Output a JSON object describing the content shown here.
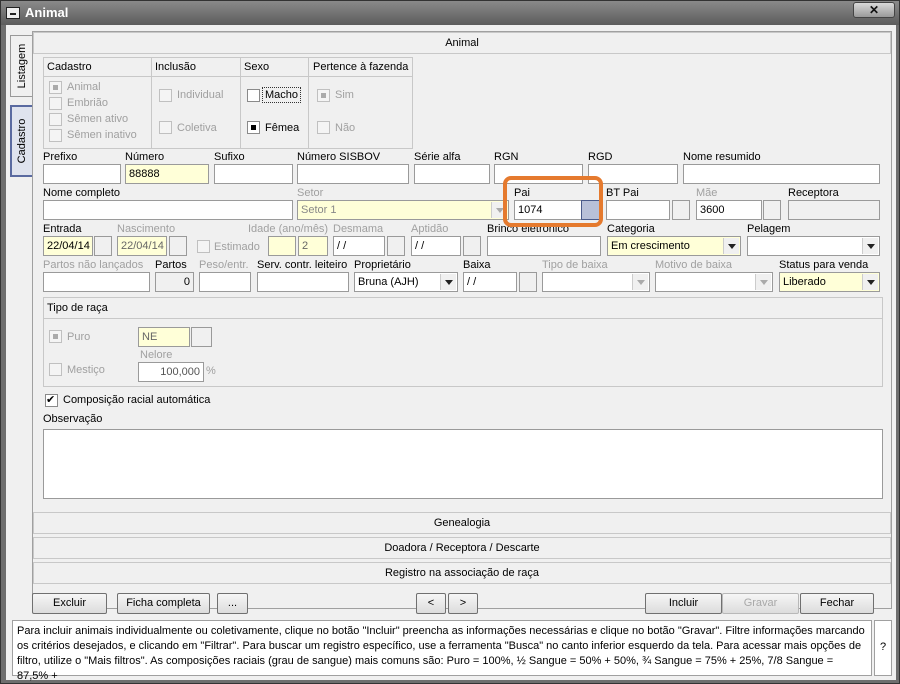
{
  "window": {
    "title": "Animal",
    "close": "✕"
  },
  "side_tabs": {
    "listagem": "Listagem",
    "cadastro": "Cadastro"
  },
  "sections": {
    "animal": "Animal",
    "genealogia": "Genealogia",
    "doadora": "Doadora / Receptora / Descarte",
    "registro": "Registro na associação de raça"
  },
  "cadastro_group": {
    "header": "Cadastro",
    "items": [
      "Animal",
      "Embrião",
      "Sêmen ativo",
      "Sêmen inativo"
    ]
  },
  "inclusao_group": {
    "header": "Inclusão",
    "items": [
      "Individual",
      "Coletiva"
    ]
  },
  "sexo_group": {
    "header": "Sexo",
    "items": [
      "Macho",
      "Fêmea"
    ]
  },
  "pertence_group": {
    "header": "Pertence à fazenda",
    "items": [
      "Sim",
      "Não"
    ]
  },
  "labels": {
    "prefixo": "Prefixo",
    "numero": "Número",
    "sufixo": "Sufixo",
    "sisbov": "Número SISBOV",
    "serie_alfa": "Série alfa",
    "rgn": "RGN",
    "rgd": "RGD",
    "nome_resumido": "Nome resumido",
    "nome_completo": "Nome completo",
    "setor": "Setor",
    "pai": "Pai",
    "bt_pai": "BT Pai",
    "mae": "Mãe",
    "receptora": "Receptora",
    "entrada": "Entrada",
    "nascimento": "Nascimento",
    "idade": "Idade (ano/mês)",
    "desmama": "Desmama",
    "aptidao": "Aptidão",
    "brinco": "Brinco eletrônico",
    "categoria": "Categoria",
    "pelagem": "Pelagem",
    "partos_nao_lancados": "Partos não lançados",
    "partos": "Partos",
    "peso_entr": "Peso/entr.",
    "serv_contr": "Serv. contr. leiteiro",
    "proprietario": "Proprietário",
    "baixa": "Baixa",
    "tipo_baixa": "Tipo de baixa",
    "motivo_baixa": "Motivo de baixa",
    "status_venda": "Status para venda",
    "tipo_raca": "Tipo de raça",
    "puro": "Puro",
    "mestico": "Mestiço",
    "nelore": "Nelore",
    "pct": "%",
    "composicao": "Composição racial automática",
    "observacao": "Observação",
    "estimado": "Estimado"
  },
  "values": {
    "numero": "88888",
    "setor": "Setor 1",
    "pai": "1074",
    "mae": "3600",
    "entrada": "22/04/14",
    "nascimento": "22/04/14",
    "idade": "2",
    "desmama": " / /",
    "aptidao": " / /",
    "categoria": "Em crescimento",
    "partos": "0",
    "proprietario": "Bruna (AJH)",
    "baixa": " / /",
    "status_venda": "Liberado",
    "raca_code": "NE",
    "raca_pct": "100,000"
  },
  "buttons": {
    "excluir": "Excluir",
    "ficha": "Ficha completa",
    "more": "...",
    "prev": "<",
    "next": ">",
    "incluir": "Incluir",
    "gravar": "Gravar",
    "fechar": "Fechar"
  },
  "help": {
    "text": "Para incluir animais individualmente ou coletivamente, clique no botão \"Incluir\" preencha as informações necessárias e clique no botão \"Gravar\". Filtre informações marcando os critérios desejados, e clicando em \"Filtrar\". Para buscar um registro específico, use a ferramenta \"Busca\" no canto inferior esquerdo da tela. Para acessar mais opções de filtro, utilize o \"Mais filtros\". As composições raciais (grau de sangue) mais comuns são: Puro = 100%, ½ Sangue = 50% + 50%, ¾ Sangue = 75% + 25%, 7/8 Sangue = 87,5% +",
    "q": "?"
  },
  "colors": {
    "highlight": "#e57a2e",
    "yellow_field": "#ffffd8"
  }
}
